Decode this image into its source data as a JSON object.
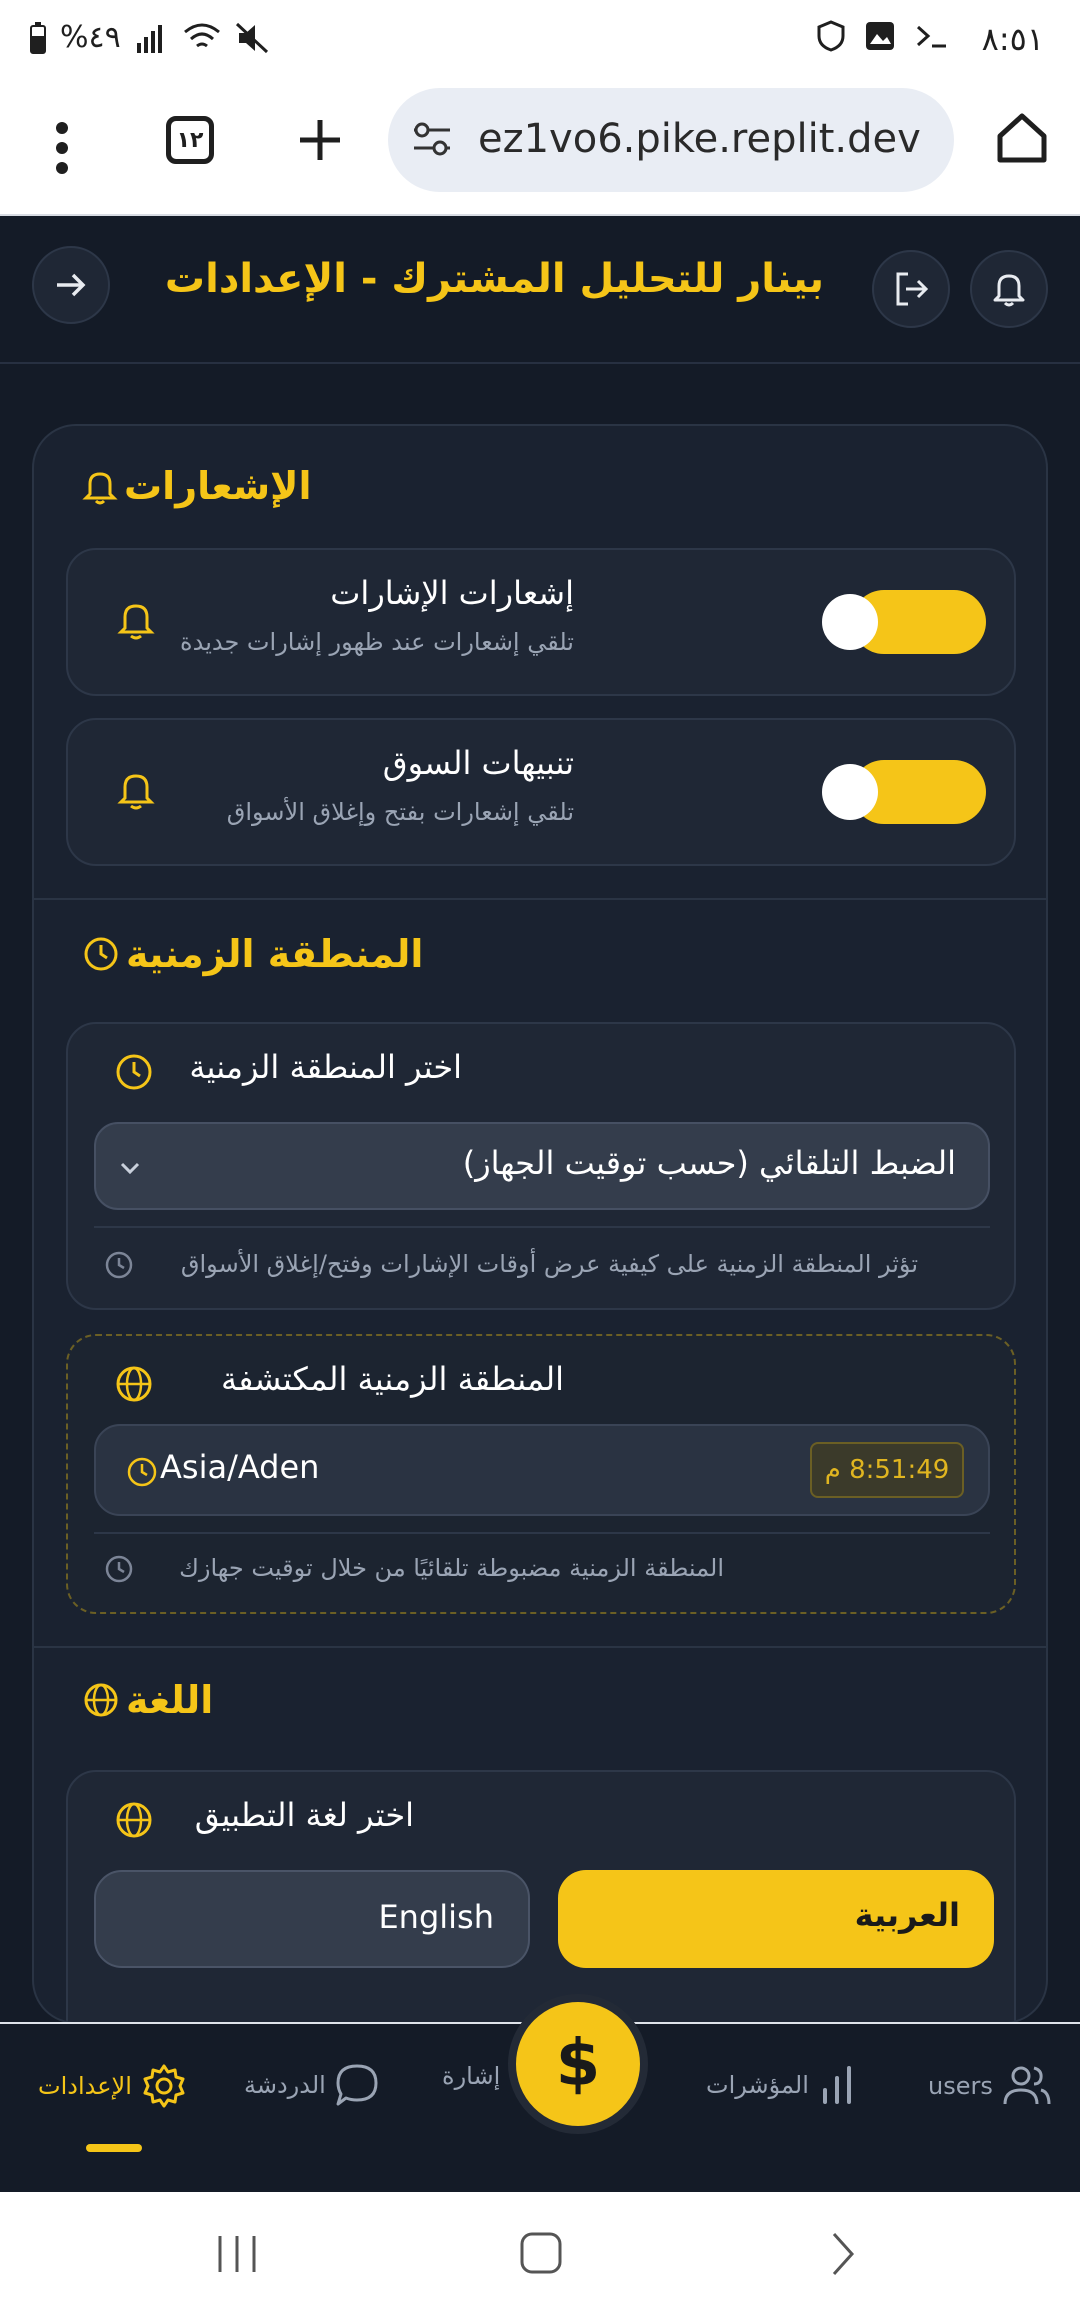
{
  "status_bar": {
    "time": "٨:٥١",
    "battery": "%٤٩"
  },
  "browser": {
    "tab_count": "١٢",
    "url": "ez1vo6.pike.replit.dev"
  },
  "header": {
    "title": "بينار للتحليل المشترك - الإعدادات"
  },
  "notifications": {
    "section_title": "الإشعارات",
    "items": [
      {
        "title": "إشعارات الإشارات",
        "subtitle": "تلقي إشعارات عند ظهور إشارات جديدة",
        "enabled": true
      },
      {
        "title": "تنبيهات السوق",
        "subtitle": "تلقي إشعارات بفتح وإغلاق الأسواق",
        "enabled": true
      }
    ]
  },
  "timezone": {
    "section_title": "المنطقة الزمنية",
    "select_label": "اختر المنطقة الزمنية",
    "selected_value": "الضبط التلقائي (حسب توقيت الجهاز)",
    "select_note": "تؤثر المنطقة الزمنية على كيفية عرض أوقات الإشارات وفتح/إغلاق الأسواق",
    "detected_label": "المنطقة الزمنية المكتشفة",
    "detected_zone": "Asia/Aden",
    "detected_time": "8:51:49 م",
    "detected_note": "المنطقة الزمنية مضبوطة تلقائيًا من خلال توقيت جهازك"
  },
  "language": {
    "section_title": "اللغة",
    "select_label": "اختر لغة التطبيق",
    "options": [
      "العربية",
      "English"
    ],
    "selected": "العربية"
  },
  "bottom_nav": {
    "items": [
      {
        "label": "الإعدادات",
        "icon": "gear-icon",
        "active": true
      },
      {
        "label": "الدردشة",
        "icon": "chat-icon",
        "active": false
      },
      {
        "label": "إشارة",
        "icon": "dollar-icon",
        "active": false
      },
      {
        "label": "المؤشرات",
        "icon": "bar-chart-icon",
        "active": false
      },
      {
        "label": "users",
        "icon": "users-icon",
        "active": false
      }
    ],
    "fab_symbol": "$"
  },
  "colors": {
    "accent": "#f5c518",
    "background": "#141b27",
    "card": "#1f2735"
  }
}
